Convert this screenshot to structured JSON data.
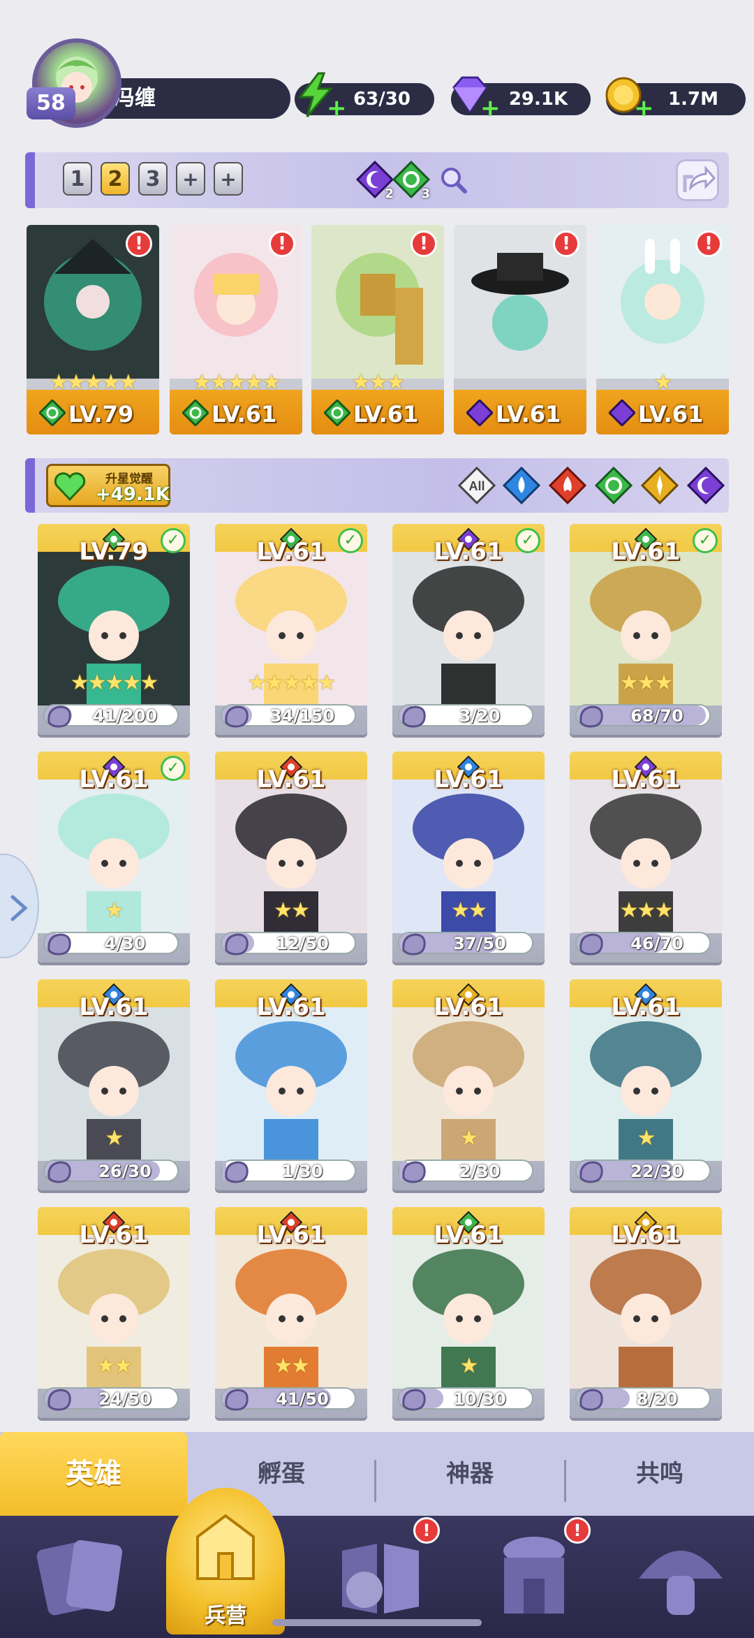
{
  "player": {
    "level": "58",
    "name": "冯缠"
  },
  "resources": [
    {
      "name": "energy",
      "icon": "lightning-icon",
      "value": "63/30",
      "color": "#57d43c"
    },
    {
      "name": "gems",
      "icon": "diamond-icon",
      "value": "29.1K",
      "color": "#8a5cf0"
    },
    {
      "name": "gold",
      "icon": "coin-icon",
      "value": "1.7M",
      "color": "#f4c22a"
    }
  ],
  "team_tabs": [
    "1",
    "2",
    "3",
    "+",
    "+"
  ],
  "team_active_index": 1,
  "team_elements": [
    {
      "icon": "moon-icon",
      "count": "2"
    },
    {
      "icon": "leaf-icon",
      "count": "3"
    }
  ],
  "team_cards": [
    {
      "stars": "★★★★★",
      "element": "leaf",
      "level": "LV.79",
      "alert": "!"
    },
    {
      "stars": "★★★★★",
      "element": "leaf",
      "level": "LV.61",
      "alert": "!"
    },
    {
      "stars": "★★★",
      "element": "leaf",
      "level": "LV.61",
      "alert": "!"
    },
    {
      "stars": "",
      "element": "moon",
      "level": "LV.61",
      "alert": "!"
    },
    {
      "stars": "★",
      "element": "moon",
      "level": "LV.61",
      "alert": "!"
    }
  ],
  "awaken": {
    "label": "升星觉醒",
    "value": "+49.1K"
  },
  "filters": [
    {
      "icon": "all-icon",
      "label": "All"
    },
    {
      "icon": "water-icon",
      "label": ""
    },
    {
      "icon": "fire-icon",
      "label": ""
    },
    {
      "icon": "leaf-icon",
      "label": ""
    },
    {
      "icon": "light-icon",
      "label": ""
    },
    {
      "icon": "moon-icon",
      "label": ""
    }
  ],
  "heroes": [
    {
      "level": "LV.79",
      "element": "leaf",
      "checked": true,
      "stars": "★★★★★",
      "shards": "41/200"
    },
    {
      "level": "LV.61",
      "element": "leaf",
      "checked": true,
      "stars": "★★★★★",
      "shards": "34/150"
    },
    {
      "level": "LV.61",
      "element": "moon",
      "checked": true,
      "stars": "",
      "shards": "3/20"
    },
    {
      "level": "LV.61",
      "element": "leaf",
      "checked": true,
      "stars": "★★★",
      "shards": "68/70"
    },
    {
      "level": "LV.61",
      "element": "moon",
      "checked": true,
      "stars": "★",
      "shards": "4/30"
    },
    {
      "level": "LV.61",
      "element": "fire",
      "checked": false,
      "stars": "★★",
      "shards": "12/50"
    },
    {
      "level": "LV.61",
      "element": "water",
      "checked": false,
      "stars": "★★",
      "shards": "37/50"
    },
    {
      "level": "LV.61",
      "element": "moon",
      "checked": false,
      "stars": "★★★",
      "shards": "46/70"
    },
    {
      "level": "LV.61",
      "element": "water",
      "checked": false,
      "stars": "★",
      "shards": "26/30"
    },
    {
      "level": "LV.61",
      "element": "water",
      "checked": false,
      "stars": "",
      "shards": "1/30"
    },
    {
      "level": "LV.61",
      "element": "light",
      "checked": false,
      "stars": "★",
      "shards": "2/30"
    },
    {
      "level": "LV.61",
      "element": "water",
      "checked": false,
      "stars": "★",
      "shards": "22/30"
    },
    {
      "level": "LV.61",
      "element": "fire",
      "checked": false,
      "stars": "★★",
      "shards": "24/50"
    },
    {
      "level": "LV.61",
      "element": "fire",
      "checked": false,
      "stars": "★★",
      "shards": "41/50"
    },
    {
      "level": "LV.61",
      "element": "leaf",
      "checked": false,
      "stars": "★",
      "shards": "10/30"
    },
    {
      "level": "LV.61",
      "element": "light",
      "checked": false,
      "stars": "",
      "shards": "8/20"
    }
  ],
  "sub_tabs": [
    "英雄",
    "孵蛋",
    "神器",
    "共鸣"
  ],
  "sub_tab_active": 0,
  "nav": {
    "center_label": "兵营",
    "items": [
      {
        "icon": "cards-icon",
        "alert": ""
      },
      {
        "icon": "barracks-icon",
        "alert": ""
      },
      {
        "icon": "book-icon",
        "alert": "!"
      },
      {
        "icon": "temple-icon",
        "alert": "!"
      },
      {
        "icon": "mushroom-icon",
        "alert": ""
      }
    ]
  },
  "element_colors": {
    "leaf": "#3cb84a",
    "moon": "#7b3fd6",
    "fire": "#e0402a",
    "water": "#2f86e0",
    "light": "#e8b020"
  }
}
